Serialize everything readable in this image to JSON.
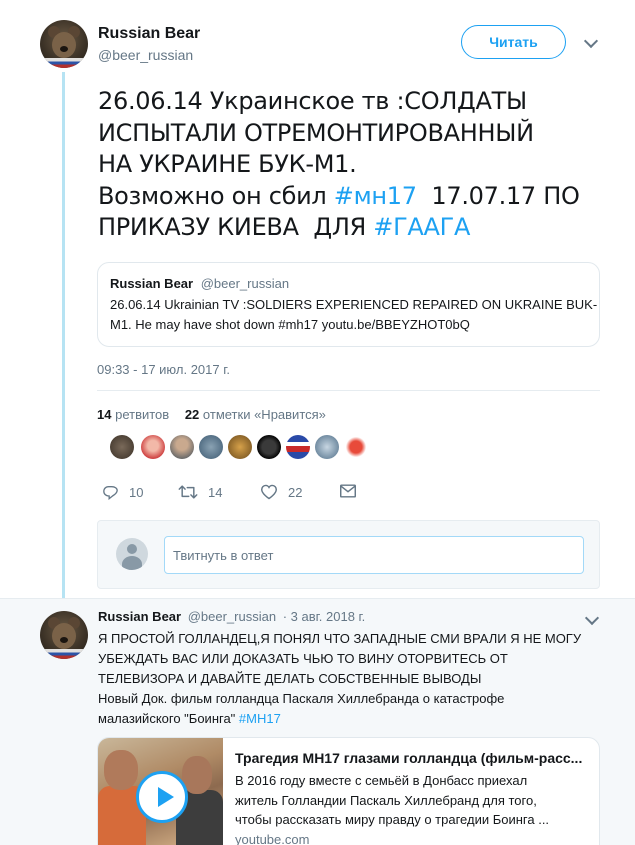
{
  "main_tweet": {
    "author_name": "Russian Bear",
    "author_handle": "@beer_russian",
    "follow_label": "Читать",
    "text_lines": [
      {
        "pre": "26.06.14 Украинское тв :СОЛДАТЫ",
        "tag": "",
        "post": ""
      },
      {
        "pre": "ИСПЫТАЛИ ОТРЕМОНТИРОВАННЫЙ",
        "tag": "",
        "post": ""
      },
      {
        "pre": "НА УКРАИНЕ БУК-М1.",
        "tag": "",
        "post": ""
      },
      {
        "pre": "Возможно он сбил ",
        "tag": "#мн17",
        "post": "  17.07.17 ПО"
      },
      {
        "pre": "ПРИКАЗУ КИЕВА  ДЛЯ ",
        "tag": "#ГААГА",
        "post": ""
      }
    ],
    "quote": {
      "name": "Russian Bear",
      "handle": "@beer_russian",
      "line1": "26.06.14 Ukrainian TV :SOLDIERS EXPERIENCED REPAIRED ON UKRAINE BUK-",
      "line2": "M1. He may have shot down #mh17 youtu.be/BBEYZHOT0bQ"
    },
    "timestamp": "09:33 - 17 июл. 2017 г.",
    "retweets_count": "14",
    "retweets_label": "ретвитов",
    "likes_count": "22",
    "likes_label": "отметки «Нравится»",
    "actions": {
      "reply_count": "10",
      "retweet_count": "14",
      "like_count": "22"
    },
    "reply_placeholder": "Твитнуть в ответ"
  },
  "second_tweet": {
    "author_name": "Russian Bear",
    "author_handle": "@beer_russian",
    "date": "· 3 авг. 2018 г.",
    "text_lines": [
      "Я ПРОСТОЙ ГОЛЛАНДЕЦ,Я ПОНЯЛ ЧТО ЗАПАДНЫЕ СМИ ВРАЛИ Я НЕ МОГУ",
      "УБЕЖДАТЬ ВАС ИЛИ ДОКАЗАТЬ ЧЬЮ ТО ВИНУ ОТОРВИТЕСЬ ОТ",
      "ТЕЛЕВИЗОРА И ДАВАЙТЕ ДЕЛАТЬ СОБСТВЕННЫЕ ВЫВОДЫ",
      "Новый Док. фильм голландца Паскаля Хиллебранда о катастрофе"
    ],
    "last_line_pre": "малазийского \"Боинга\" ",
    "last_line_tag": "#МН17",
    "card": {
      "title": "Трагедия МН17 глазами голландца (фильм-расс...",
      "desc_lines": [
        "В 2016 году вместе с семьёй в Донбасс приехал",
        "житель Голландии Паскаль Хиллебранд для того,",
        "чтобы рассказать миру правду о трагедии Боинга ..."
      ],
      "domain": "youtube.com"
    }
  },
  "colors": {
    "accent": "#1da1f2",
    "thread_line": "#b6e3f3",
    "secondary_text": "#657786"
  }
}
